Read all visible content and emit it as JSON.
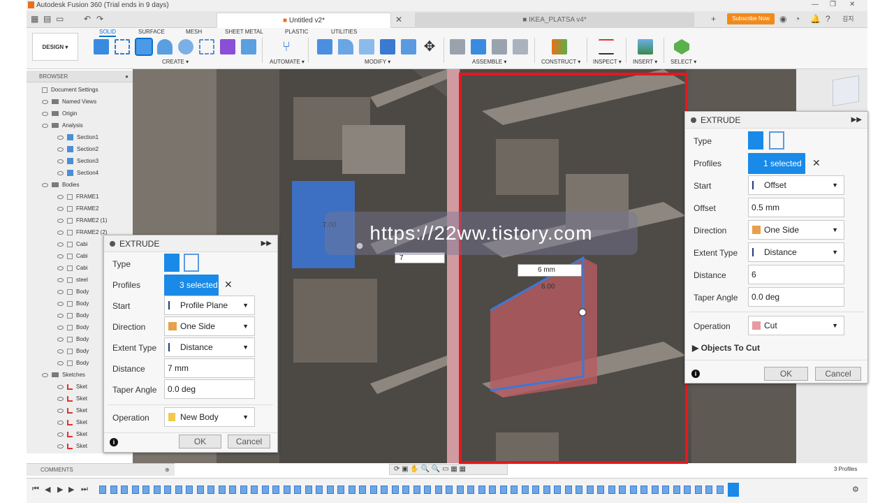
{
  "window": {
    "title": "Autodesk Fusion 360 (Trial ends in 9 days)"
  },
  "tabs": [
    {
      "label": "Untitled v2*"
    },
    {
      "label": "IKEA_PLATSA v4*"
    }
  ],
  "header": {
    "subscribe": "Subscribe Now",
    "user": "김지"
  },
  "ribbon": {
    "workspace": "DESIGN ▾",
    "tabs": [
      "SOLID",
      "SURFACE",
      "MESH",
      "SHEET METAL",
      "PLASTIC",
      "UTILITIES"
    ],
    "groups": [
      "CREATE ▾",
      "AUTOMATE ▾",
      "MODIFY ▾",
      "ASSEMBLE ▾",
      "CONSTRUCT ▾",
      "INSPECT ▾",
      "INSERT ▾",
      "SELECT ▾"
    ]
  },
  "browser": {
    "title": "BROWSER",
    "items": [
      {
        "label": "Document Settings",
        "type": "gear"
      },
      {
        "label": "Named Views",
        "type": "folder"
      },
      {
        "label": "Origin",
        "type": "folder"
      },
      {
        "label": "Analysis",
        "type": "folder"
      },
      {
        "label": "Section1",
        "type": "section"
      },
      {
        "label": "Section2",
        "type": "section"
      },
      {
        "label": "Section3",
        "type": "section"
      },
      {
        "label": "Section4",
        "type": "section"
      },
      {
        "label": "Bodies",
        "type": "folder"
      },
      {
        "label": "FRAME1",
        "type": "body"
      },
      {
        "label": "FRAME2",
        "type": "body"
      },
      {
        "label": "FRAME2 (1)",
        "type": "body"
      },
      {
        "label": "FRAME2 (2)",
        "type": "body"
      },
      {
        "label": "Cabi",
        "type": "body"
      },
      {
        "label": "Cabi",
        "type": "body"
      },
      {
        "label": "Cabi",
        "type": "body"
      },
      {
        "label": "steel",
        "type": "body"
      },
      {
        "label": "Body",
        "type": "body"
      },
      {
        "label": "Body",
        "type": "body"
      },
      {
        "label": "Body",
        "type": "body"
      },
      {
        "label": "Body",
        "type": "body"
      },
      {
        "label": "Body",
        "type": "body"
      },
      {
        "label": "Body",
        "type": "body"
      },
      {
        "label": "Body",
        "type": "body"
      },
      {
        "label": "Sketches",
        "type": "folder"
      },
      {
        "label": "Sket",
        "type": "sketch"
      },
      {
        "label": "Sket",
        "type": "sketch"
      },
      {
        "label": "Sket",
        "type": "sketch"
      },
      {
        "label": "Sket",
        "type": "sketch"
      },
      {
        "label": "Sket",
        "type": "sketch"
      },
      {
        "label": "Sket",
        "type": "sketch"
      }
    ]
  },
  "comments": {
    "label": "COMMENTS"
  },
  "extrude_left": {
    "title": "EXTRUDE",
    "labels": {
      "type": "Type",
      "profiles": "Profiles",
      "start": "Start",
      "direction": "Direction",
      "extent_type": "Extent Type",
      "distance": "Distance",
      "taper": "Taper Angle",
      "operation": "Operation"
    },
    "profiles": "3 selected",
    "start": "Profile Plane",
    "direction": "One Side",
    "extent_type": "Distance",
    "distance": "7 mm",
    "taper": "0.0 deg",
    "operation": "New Body",
    "ok": "OK",
    "cancel": "Cancel"
  },
  "extrude_right": {
    "title": "EXTRUDE",
    "labels": {
      "type": "Type",
      "profiles": "Profiles",
      "start": "Start",
      "offset": "Offset",
      "direction": "Direction",
      "extent_type": "Extent Type",
      "distance": "Distance",
      "taper": "Taper Angle",
      "operation": "Operation",
      "objects_to_cut": "Objects To Cut"
    },
    "profiles": "1 selected",
    "start": "Offset",
    "offset": "0.5 mm",
    "direction": "One Side",
    "extent_type": "Distance",
    "distance": "6",
    "taper": "0.0 deg",
    "operation": "Cut",
    "ok": "OK",
    "cancel": "Cancel"
  },
  "viewport": {
    "watermark": "https://22ww.tistory.com",
    "dim_left_value": "7",
    "dim_left_label": "7.00",
    "dim_right_value": "6 mm",
    "dim_right_label": "6.00",
    "status": "3 Profiles"
  },
  "colors": {
    "accent": "#1a8ae8",
    "highlight": "#e8161d",
    "subscribe": "#f28a1a"
  }
}
